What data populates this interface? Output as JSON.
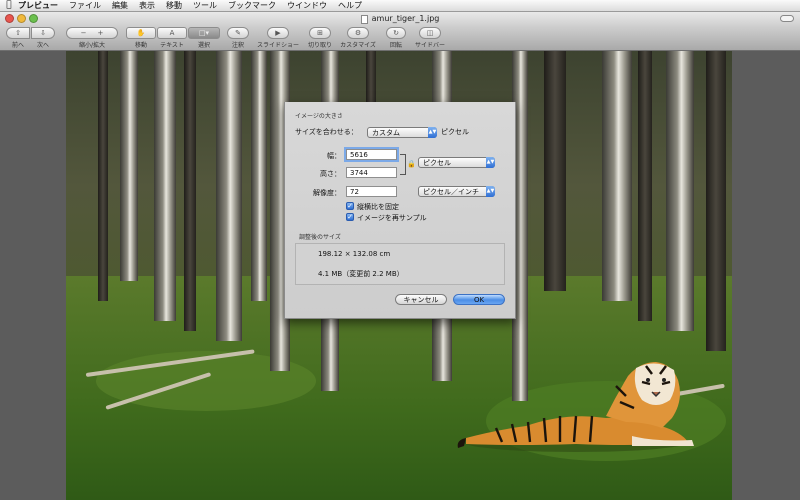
{
  "menubar": {
    "apple": "",
    "items": [
      "プレビュー",
      "ファイル",
      "編集",
      "表示",
      "移動",
      "ツール",
      "ブックマーク",
      "ウインドウ",
      "ヘルプ"
    ]
  },
  "window": {
    "title": "amur_tiger_1.jpg"
  },
  "toolbar": {
    "back": "前へ",
    "forward": "次へ",
    "zoom": "縮小/拡大",
    "move": "移動",
    "text": "テキスト",
    "select": "選択",
    "annotate": "注釈",
    "slideshow": "スライドショー",
    "crop": "切り取り",
    "customize": "カスタマイズ",
    "rotate": "回転",
    "sidebar": "サイドバー"
  },
  "dialog": {
    "section_size": "イメージの大きさ",
    "fit_label": "サイズを合わせる：",
    "fit_value": "カスタム",
    "fit_unit": "ピクセル",
    "width_label": "幅：",
    "width_value": "5616",
    "height_label": "高さ：",
    "height_value": "3744",
    "resolution_label": "解像度：",
    "resolution_value": "72",
    "size_unit": "ピクセル",
    "resolution_unit": "ピクセル／インチ",
    "keep_ratio_label": "縦横比を固定",
    "keep_ratio_checked": true,
    "resample_label": "イメージを再サンプル",
    "resample_checked": true,
    "section_result": "調整後のサイズ",
    "result_dimensions": "198.12 × 132.08 cm",
    "result_filesize": "4.1 MB（変更前 2.2 MB）",
    "cancel_label": "キャンセル",
    "ok_label": "OK"
  },
  "colors": {
    "accent": "#3c7fe0",
    "sheet_bg": "#d4d4d4"
  }
}
